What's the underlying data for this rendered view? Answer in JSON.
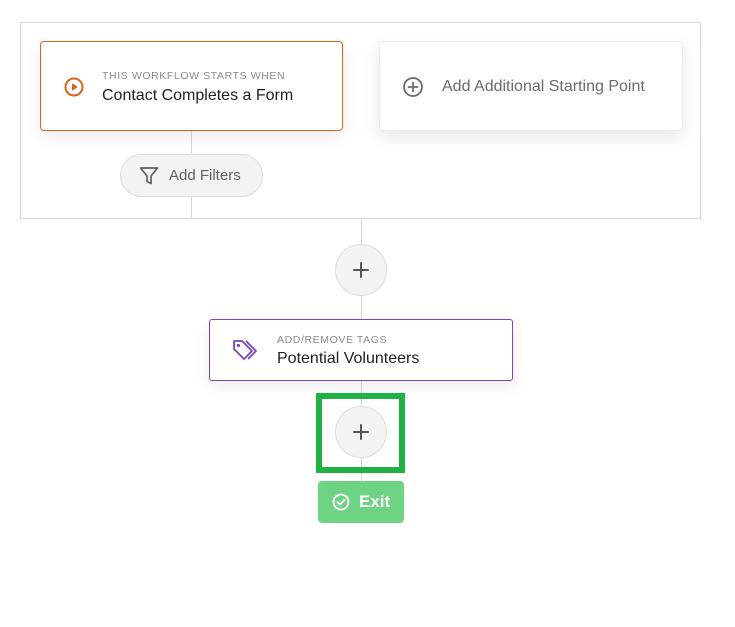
{
  "trigger": {
    "kicker": "THIS WORKFLOW STARTS WHEN",
    "title": "Contact Completes a Form",
    "icon": "play-circle-icon"
  },
  "add_starting_point": {
    "label": "Add Additional Starting Point",
    "icon": "plus-circle-icon"
  },
  "filters": {
    "label": "Add Filters",
    "icon": "filter-icon"
  },
  "action": {
    "kicker": "ADD/REMOVE TAGS",
    "title": "Potential Volunteers",
    "icon": "tag-icon"
  },
  "add_step_buttons": {
    "label": "+",
    "count_visible": 2
  },
  "exit": {
    "label": "Exit",
    "icon": "check-circle-icon"
  },
  "colors": {
    "trigger_accent": "#d9661c",
    "action_accent": "#7a45c4",
    "exit_green": "#6fd384",
    "highlight_green": "#1fb144"
  }
}
